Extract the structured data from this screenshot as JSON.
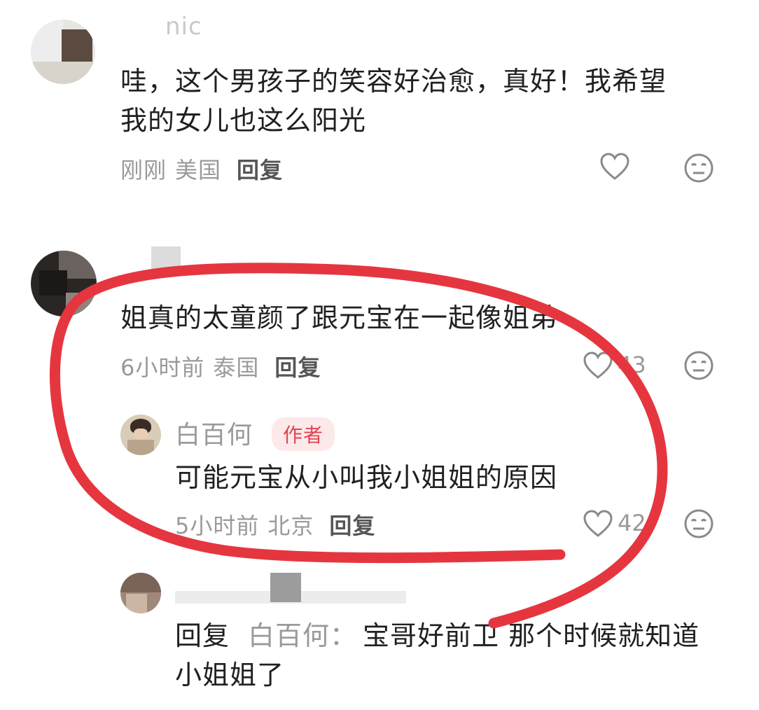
{
  "comments": [
    {
      "name_fragment": "nic",
      "text_line1": "哇，这个男孩子的笑容好治愈，真好！我希望",
      "text_line2": "我的女儿也这么阳光",
      "time": "刚刚",
      "location": "美国",
      "reply_label": "回复",
      "likes": ""
    },
    {
      "text": "姐真的太童颜了跟元宝在一起像姐弟",
      "time": "6小时前",
      "location": "泰国",
      "reply_label": "回复",
      "likes": "43",
      "reply": {
        "name": "白百何",
        "badge": "作者",
        "text": "可能元宝从小叫我小姐姐的原因",
        "time": "5小时前",
        "location": "北京",
        "reply_label": "回复",
        "likes": "42"
      },
      "sub_reply": {
        "prefix": "回复",
        "target": "白百何：",
        "text_line1": "宝哥好前卫 那个时候就知道",
        "text_line2": "小姐姐了"
      }
    }
  ],
  "annotation": {
    "color": "#e5363f"
  },
  "icons": {
    "like": "heart-outline-icon",
    "dislike": "neutral-face-icon"
  }
}
